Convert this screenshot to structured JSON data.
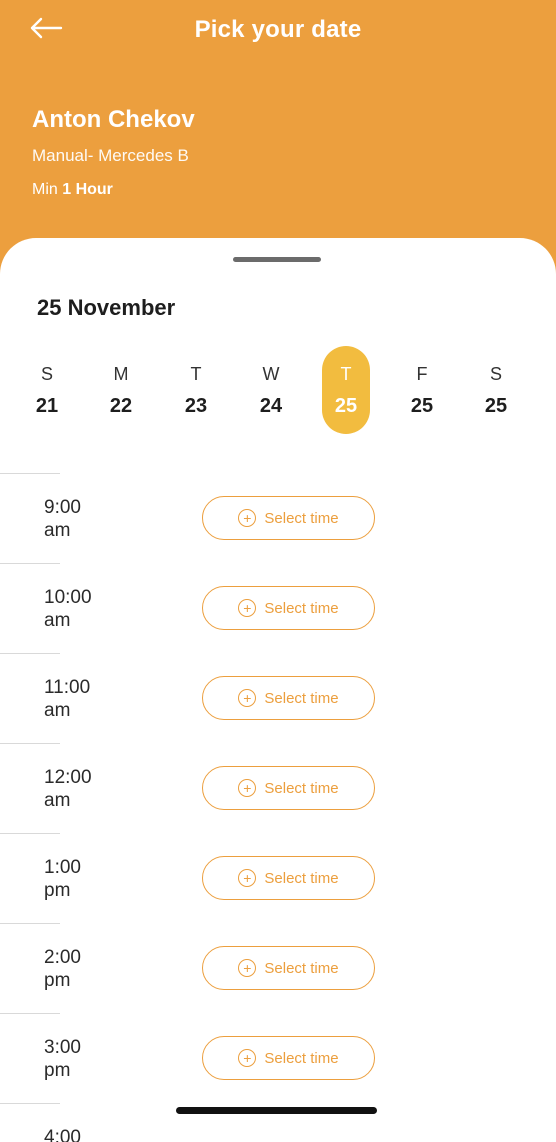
{
  "header": {
    "title": "Pick your date",
    "back_icon": "arrow-left-icon",
    "background_color": "#EC9F3E"
  },
  "instructor": {
    "name": "Anton Chekov",
    "car": "Manual- Mercedes B",
    "min_label": "Min",
    "min_value": "1 Hour"
  },
  "calendar": {
    "month_label": "25 November",
    "days": [
      {
        "dow": "S",
        "num": "21",
        "selected": false
      },
      {
        "dow": "M",
        "num": "22",
        "selected": false
      },
      {
        "dow": "T",
        "num": "23",
        "selected": false
      },
      {
        "dow": "W",
        "num": "24",
        "selected": false
      },
      {
        "dow": "T",
        "num": "25",
        "selected": true
      },
      {
        "dow": "F",
        "num": "25",
        "selected": false
      },
      {
        "dow": "S",
        "num": "25",
        "selected": false
      }
    ],
    "selected_color": "#F2BC3F"
  },
  "slots": [
    {
      "time": "9:00",
      "period": "am",
      "button": "Select time"
    },
    {
      "time": "10:00",
      "period": "am",
      "button": "Select time"
    },
    {
      "time": "11:00",
      "period": "am",
      "button": "Select time"
    },
    {
      "time": "12:00",
      "period": "am",
      "button": "Select time"
    },
    {
      "time": "1:00",
      "period": "pm",
      "button": "Select time"
    },
    {
      "time": "2:00",
      "period": "pm",
      "button": "Select time"
    },
    {
      "time": "3:00",
      "period": "pm",
      "button": "Select time"
    },
    {
      "time": "4:00",
      "period": "",
      "button": ""
    }
  ],
  "accent_color": "#EC9F3E"
}
